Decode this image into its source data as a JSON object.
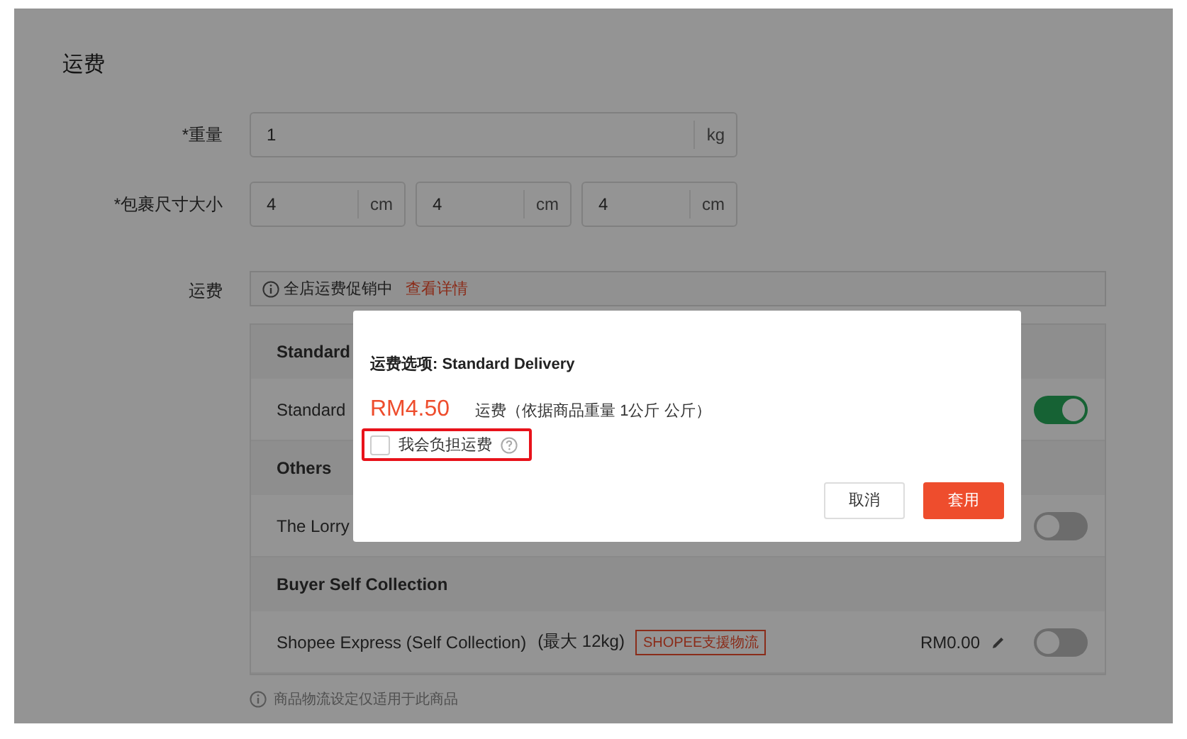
{
  "section_title": "运费",
  "weight": {
    "label": "*重量",
    "value": "1",
    "unit": "kg"
  },
  "size": {
    "label": "*包裹尺寸大小",
    "fields": [
      {
        "value": "4",
        "unit": "cm"
      },
      {
        "value": "4",
        "unit": "cm"
      },
      {
        "value": "4",
        "unit": "cm"
      }
    ]
  },
  "shipping": {
    "label": "运费",
    "promo": {
      "text": "全店运费促销中",
      "link": "查看详情"
    },
    "rows": [
      {
        "kind": "header",
        "title": "Standard"
      },
      {
        "kind": "option",
        "name": "Standard",
        "on": true
      },
      {
        "kind": "header",
        "title": "Others"
      },
      {
        "kind": "option",
        "name": "The Lorry",
        "on": false
      },
      {
        "kind": "header",
        "title": "Buyer Self Collection"
      },
      {
        "kind": "option",
        "name": "Shopee Express (Self Collection)",
        "limit": "(最大 12kg)",
        "tag": "SHOPEE支援物流",
        "price": "RM0.00",
        "on": false
      }
    ]
  },
  "footnote": "商品物流设定仅适用于此商品",
  "dialog": {
    "title": "运费选项: Standard Delivery",
    "price": "RM4.50",
    "price_note": "运费（依据商品重量 1公斤 公斤）",
    "checkbox": {
      "label": "我会负担运费",
      "checked": false,
      "highlighted": true
    },
    "buttons": [
      {
        "label": "取消",
        "kind": "secondary"
      },
      {
        "label": "套用",
        "kind": "primary"
      }
    ]
  }
}
